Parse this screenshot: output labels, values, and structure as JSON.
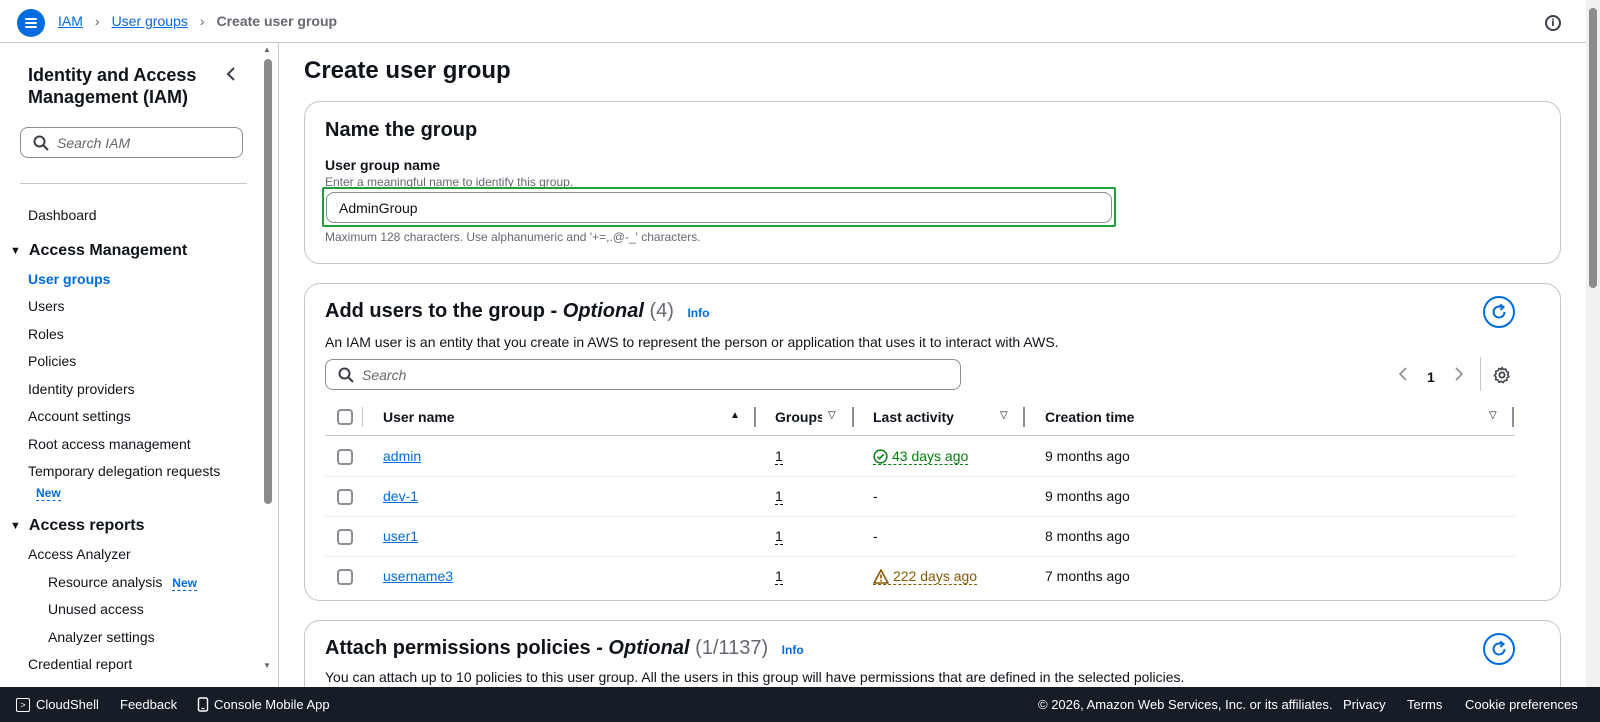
{
  "header": {
    "breadcrumbs": [
      "IAM",
      "User groups"
    ],
    "current": "Create user group",
    "sep": "›"
  },
  "sidebar": {
    "title": "Identity and Access Management (IAM)",
    "search_placeholder": "Search IAM",
    "dashboard": "Dashboard",
    "section_access_management": "Access Management",
    "items": [
      "User groups",
      "Users",
      "Roles",
      "Policies",
      "Identity providers",
      "Account settings",
      "Root access management",
      "Temporary delegation requests"
    ],
    "new_badge": "New",
    "section_access_reports": "Access reports",
    "access_analyzer": "Access Analyzer",
    "sub_items": [
      "Resource analysis",
      "Unused access",
      "Analyzer settings"
    ],
    "credential_report": "Credential report"
  },
  "main": {
    "title": "Create user group",
    "name_card": {
      "heading": "Name the group",
      "label": "User group name",
      "description": "Enter a meaningful name to identify this group.",
      "value": "AdminGroup",
      "constraint": "Maximum 128 characters. Use alphanumeric and '+=,.@-_' characters."
    },
    "users_card": {
      "heading": "Add users to the group - ",
      "optional": "Optional",
      "count": "(4)",
      "info": "Info",
      "description": "An IAM user is an entity that you create in AWS to represent the person or application that uses it to interact with AWS.",
      "search_placeholder": "Search",
      "page": "1",
      "columns": [
        "User name",
        "Groups",
        "Last activity",
        "Creation time"
      ],
      "rows": [
        {
          "name": "admin",
          "groups": "1",
          "activity": "43 days ago",
          "status": "ok",
          "created": "9 months ago"
        },
        {
          "name": "dev-1",
          "groups": "1",
          "activity": "-",
          "status": "none",
          "created": "9 months ago"
        },
        {
          "name": "user1",
          "groups": "1",
          "activity": "-",
          "status": "none",
          "created": "8 months ago"
        },
        {
          "name": "username3",
          "groups": "1",
          "activity": "222 days ago",
          "status": "warn",
          "created": "7 months ago"
        }
      ]
    },
    "policies_card": {
      "heading": "Attach permissions policies - ",
      "optional": "Optional",
      "count": "(1/1137)",
      "info": "Info",
      "description": "You can attach up to 10 policies to this user group. All the users in this group will have permissions that are defined in the selected policies."
    }
  },
  "footer": {
    "cloudshell": "CloudShell",
    "feedback": "Feedback",
    "mobile": "Console Mobile App",
    "copyright": "© 2026, Amazon Web Services, Inc. or its affiliates.",
    "privacy": "Privacy",
    "terms": "Terms",
    "cookies": "Cookie preferences"
  },
  "colors": {
    "accent": "#006ce0",
    "success": "#037f0c",
    "warning": "#855900",
    "footer_bg": "#161d26"
  }
}
